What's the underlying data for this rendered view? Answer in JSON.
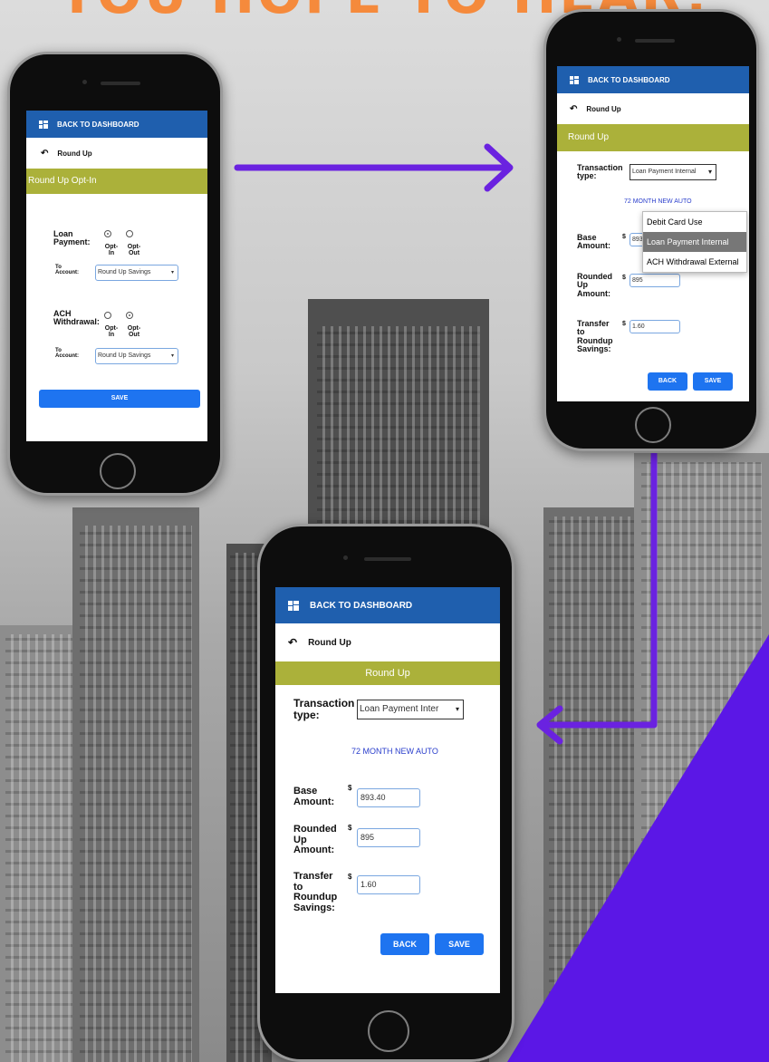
{
  "headline": "YOU HOPE TO HEAR!",
  "colors": {
    "accent_orange": "#f58a3c",
    "purple": "#5b17e6",
    "header_blue": "#1f5fae",
    "olive": "#abb13a",
    "button_blue": "#1e74f0"
  },
  "phone1": {
    "back_label": "BACK TO DASHBOARD",
    "nav_title": "Round Up",
    "section_title": "Round Up Opt-In",
    "loan": {
      "label": "Loan Payment:",
      "opt_in": "Opt-In",
      "opt_out": "Opt-Out",
      "selected": "opt_in",
      "to_account_label": "To Account:",
      "to_account_value": "Round Up Savings"
    },
    "ach": {
      "label": "ACH Withdrawal:",
      "opt_in": "Opt-In",
      "opt_out": "Opt-Out",
      "selected": "opt_out",
      "to_account_label": "To Account:",
      "to_account_value": "Round Up Savings"
    },
    "save_label": "SAVE"
  },
  "phone2": {
    "back_label": "BACK TO DASHBOARD",
    "nav_title": "Round Up",
    "section_title": "Round Up",
    "transaction_label": "Transaction type:",
    "transaction_value": "Loan Payment Internal",
    "loan_name": "72 MONTH NEW AUTO",
    "dropdown_options": [
      "Debit Card Use",
      "Loan Payment Internal",
      "ACH Withdrawal External"
    ],
    "dropdown_highlighted": "Loan Payment Internal",
    "base_label": "Base Amount:",
    "base_value": "893.40",
    "rounded_label": "Rounded Up Amount:",
    "rounded_value": "895",
    "transfer_label": "Transfer to Roundup Savings:",
    "transfer_value": "1.60",
    "currency": "$",
    "back_btn": "BACK",
    "save_btn": "SAVE"
  },
  "phone3": {
    "back_label": "BACK TO DASHBOARD",
    "nav_title": "Round Up",
    "section_title": "Round Up",
    "transaction_label": "Transaction type:",
    "transaction_value": "Loan Payment Inter",
    "loan_name": "72 MONTH NEW AUTO",
    "base_label": "Base Amount:",
    "base_value": "893.40",
    "rounded_label": "Rounded Up Amount:",
    "rounded_value": "895",
    "transfer_label": "Transfer to Roundup Savings:",
    "transfer_value": "1.60",
    "currency": "$",
    "back_btn": "BACK",
    "save_btn": "SAVE"
  }
}
